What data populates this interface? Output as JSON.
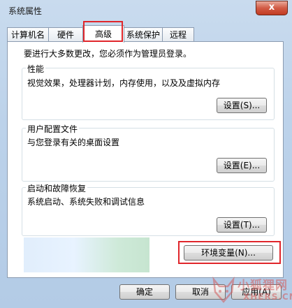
{
  "window": {
    "title": "系统属性",
    "close_label": "x"
  },
  "tabs": [
    {
      "label": "计算机名"
    },
    {
      "label": "硬件"
    },
    {
      "label": "高级",
      "active": true
    },
    {
      "label": "系统保护"
    },
    {
      "label": "远程"
    }
  ],
  "intro_text": "要进行大多数更改，您必须作为管理员登录。",
  "groups": {
    "performance": {
      "title": "性能",
      "description": "视觉效果，处理器计划，内存使用，以及及虚拟内存",
      "button": "设置(S)..."
    },
    "user_profiles": {
      "title": "用户配置文件",
      "description": "与您登录有关的桌面设置",
      "button": "设置(E)..."
    },
    "startup_recovery": {
      "title": "启动和故障恢复",
      "description": "系统启动、系统失败和调试信息",
      "button": "设置(T)..."
    }
  },
  "env_button": "环境变量(N)...",
  "footer": {
    "ok": "确定",
    "cancel": "取消",
    "apply": "应用(A)"
  },
  "watermark": {
    "cn": "小狐狸网",
    "en": "XHERS.CN"
  },
  "colors": {
    "highlight": "#e0262b",
    "close_button": "#c23b22"
  }
}
